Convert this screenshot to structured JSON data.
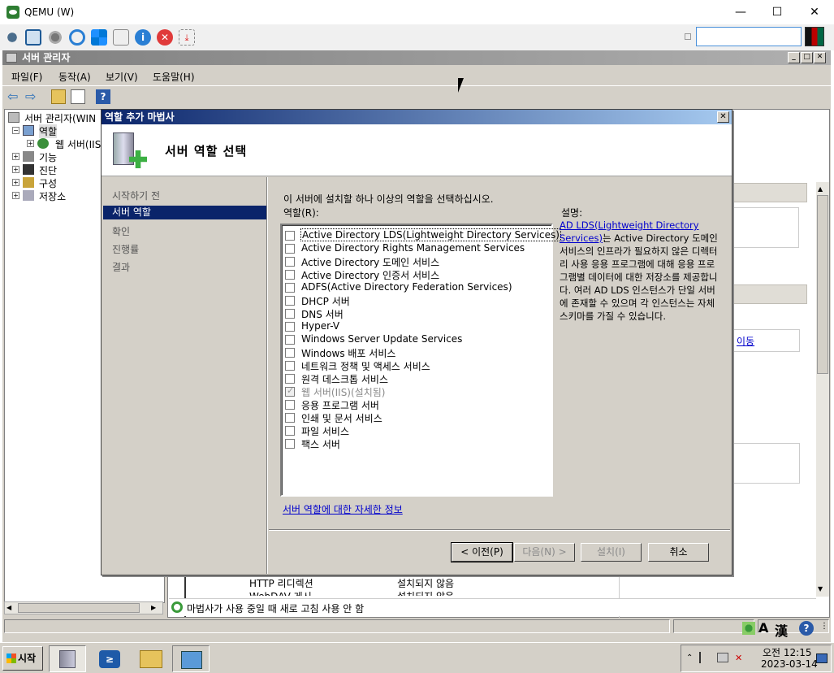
{
  "qemu": {
    "title": "QEMU (W)",
    "controls": {
      "minimize": "—",
      "maximize": "☐",
      "close": "✕"
    }
  },
  "server_manager": {
    "title": "서버 관리자",
    "menu": [
      "파일(F)",
      "동작(A)",
      "보기(V)",
      "도움말(H)"
    ],
    "tree": {
      "root": "서버 관리자(WIN",
      "roles": "역할",
      "web_server": "웹 서버(IIS",
      "features": "기능",
      "diagnostics": "진단",
      "configuration": "구성",
      "storage": "저장소"
    },
    "background_rows": [
      {
        "name": "HTTP 리디렉션",
        "status": "설치되지 않음"
      },
      {
        "name": "WebDAV 게시",
        "status": "설치되지 않음"
      }
    ],
    "bg_link": "이동",
    "status_text": "마법사가 사용 중일 때 새로 고침 사용 안 함"
  },
  "wizard": {
    "title": "역할 추가 마법사",
    "header": "서버 역할 선택",
    "nav": [
      {
        "label": "시작하기 전",
        "active": false
      },
      {
        "label": "서버 역할",
        "active": true
      },
      {
        "label": "확인",
        "active": false
      },
      {
        "label": "진행률",
        "active": false
      },
      {
        "label": "결과",
        "active": false
      }
    ],
    "instruction": "이 서버에 설치할 하나 이상의 역할을 선택하십시오.",
    "roles_label": "역할(R):",
    "roles": [
      {
        "label": "Active Directory LDS(Lightweight Directory Services)",
        "checked": false,
        "disabled": false,
        "selected": true
      },
      {
        "label": "Active Directory Rights Management Services",
        "checked": false,
        "disabled": false
      },
      {
        "label": "Active Directory 도메인 서비스",
        "checked": false,
        "disabled": false
      },
      {
        "label": "Active Directory 인증서 서비스",
        "checked": false,
        "disabled": false
      },
      {
        "label": "ADFS(Active Directory Federation Services)",
        "checked": false,
        "disabled": false
      },
      {
        "label": "DHCP 서버",
        "checked": false,
        "disabled": false
      },
      {
        "label": "DNS 서버",
        "checked": false,
        "disabled": false
      },
      {
        "label": "Hyper-V",
        "checked": false,
        "disabled": false
      },
      {
        "label": "Windows Server Update Services",
        "checked": false,
        "disabled": false
      },
      {
        "label": "Windows 배포 서비스",
        "checked": false,
        "disabled": false
      },
      {
        "label": "네트워크 정책 및 액세스 서비스",
        "checked": false,
        "disabled": false
      },
      {
        "label": "원격 데스크톱 서비스",
        "checked": false,
        "disabled": false
      },
      {
        "label": "웹 서버(IIS)(설치됨)",
        "checked": true,
        "disabled": true
      },
      {
        "label": "응용 프로그램 서버",
        "checked": false,
        "disabled": false
      },
      {
        "label": "인쇄 및 문서 서비스",
        "checked": false,
        "disabled": false
      },
      {
        "label": "파일 서비스",
        "checked": false,
        "disabled": false
      },
      {
        "label": "팩스 서버",
        "checked": false,
        "disabled": false
      }
    ],
    "more_info_link": "서버 역할에 대한 자세한 정보",
    "description_label": "설명:",
    "description_link": "AD LDS(Lightweight Directory Services)",
    "description_text": "는 Active Directory 도메인 서비스의 인프라가 필요하지 않은 디렉터리 사용 응용 프로그램에 대해 응용 프로그램별 데이터에 대한 저장소를 제공합니다. 여러 AD LDS 인스턴스가 단일 서버에 존재할 수 있으며 각 인스턴스는 자체 스키마를 가질 수 있습니다.",
    "buttons": {
      "back": "< 이전(P)",
      "next": "다음(N) >",
      "install": "설치(I)",
      "cancel": "취소"
    }
  },
  "taskbar": {
    "start": "시작",
    "clock_time": "오전 12:15",
    "clock_date": "2023-03-14"
  },
  "language_bar": {
    "mode": "A",
    "hanja": "漢"
  },
  "colors": {
    "wizard_title": "#0a246a",
    "selection": "#0a246a",
    "link": "#0000cc"
  }
}
